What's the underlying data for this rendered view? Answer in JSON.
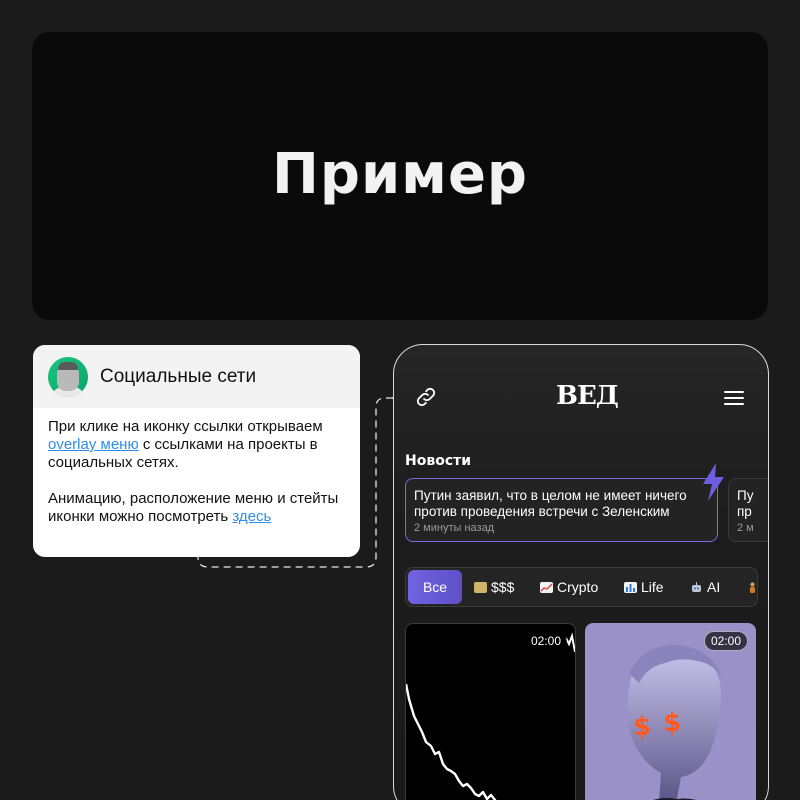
{
  "hero": {
    "title": "Пример"
  },
  "annotation": {
    "title": "Социальные сети",
    "p1_a": "При клике на иконку ссылки открываем ",
    "p1_link": "overlay меню",
    "p1_b": "  с ссылками на проекты в социальных сетях.",
    "p2_a": "Анимацию, расположение меню и стейты иконки можно посмотреть ",
    "p2_link": "здесь"
  },
  "app": {
    "logo": "ВЕД",
    "news_heading": "Новости",
    "news": [
      {
        "title": "Путин заявил, что в целом не имеет ничего против проведения встречи с Зеленским",
        "time": "2 минуты назад"
      },
      {
        "title": "Пу пр",
        "time": "2 м"
      }
    ],
    "tabs": [
      {
        "label": "Все",
        "icon": ""
      },
      {
        "label": "$$$",
        "icon": "money-icon"
      },
      {
        "label": "Crypto",
        "icon": "chart-up-icon"
      },
      {
        "label": "Life",
        "icon": "bar-chart-icon"
      },
      {
        "label": "AI",
        "icon": "robot-icon"
      },
      {
        "label": "",
        "icon": "person-icon"
      }
    ],
    "cards": [
      {
        "duration": "02:00"
      },
      {
        "duration": "02:00",
        "overlay": "$ $"
      }
    ]
  },
  "colors": {
    "accent": "#7064e0",
    "link": "#2f8ee6",
    "avatar_bg": "#19c37d",
    "dollar": "#ff5a1f"
  }
}
